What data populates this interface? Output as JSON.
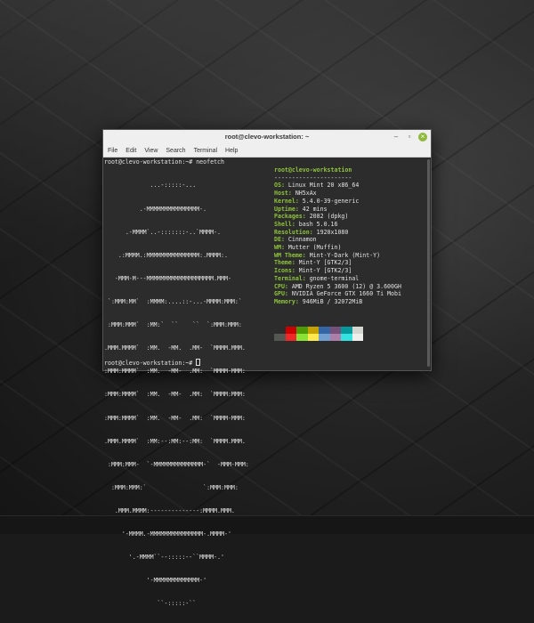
{
  "window": {
    "title": "root@clevo-workstation: ~",
    "controls": {
      "minimize": "‒",
      "maximize": "▫",
      "close": "×"
    }
  },
  "menu": [
    "File",
    "Edit",
    "View",
    "Search",
    "Terminal",
    "Help"
  ],
  "terminal": {
    "prompt_command": "root@clevo-workstation:~# neofetch",
    "ascii_logo": [
      "             ...-:::::-...",
      "          .-MMMMMMMMMMMMMMM-.",
      "      .-MMMM`..-:::::::-..`MMMM-.",
      "    .:MMMM.:MMMMMMMMMMMMMMM:.MMMM:.",
      "   -MMM-M---MMMMMMMMMMMMMMMMMMM.MMM-",
      " `:MMM:MM`  :MMMM:....::-...-MMMM:MMM:`",
      " :MMM:MMM`  :MM:`  ``    ``  `:MMM:MMM:",
      ".MMM.MMMM`  :MM.  -MM.  .MM-  `MMMM.MMM.",
      ":MMM:MMMM`  :MM.  -MM-  .MM:  `MMMM-MMM:",
      ":MMM:MMMM`  :MM.  -MM-  .MM:  `MMMM:MMM:",
      ":MMM:MMMM`  :MM.  -MM-  .MM:  `MMMM-MMM:",
      ".MMM.MMMM`  :MM:--:MM:--:MM:  `MMMM.MMM.",
      " :MMM:MMM-  `-MMMMMMMMMMMMMM-`  -MMM-MMM:",
      "  :MMM:MMM:`                `:MMM:MMM:",
      "   .MMM.MMMM:--------------:MMMM.MMM.",
      "     '-MMMM.-MMMMMMMMMMMMMMM-.MMMM-'",
      "       '.-MMMM``--:::::--``MMMM-.'",
      "            '-MMMMMMMMMMMMM-'",
      "               ``-:::::-``"
    ],
    "user_host": "root@clevo-workstation",
    "separator": "----------------------",
    "info": [
      {
        "key": "OS",
        "value": "Linux Mint 20 x86_64"
      },
      {
        "key": "Host",
        "value": "NH5xAx"
      },
      {
        "key": "Kernel",
        "value": "5.4.0-39-generic"
      },
      {
        "key": "Uptime",
        "value": "42 mins"
      },
      {
        "key": "Packages",
        "value": "2082 (dpkg)"
      },
      {
        "key": "Shell",
        "value": "bash 5.0.16"
      },
      {
        "key": "Resolution",
        "value": "1920x1080"
      },
      {
        "key": "DE",
        "value": "Cinnamon"
      },
      {
        "key": "WM",
        "value": "Mutter (Muffin)"
      },
      {
        "key": "WM Theme",
        "value": "Mint-Y-Dark (Mint-Y)"
      },
      {
        "key": "Theme",
        "value": "Mint-Y [GTK2/3]"
      },
      {
        "key": "Icons",
        "value": "Mint-Y [GTK2/3]"
      },
      {
        "key": "Terminal",
        "value": "gnome-terminal"
      },
      {
        "key": "CPU",
        "value": "AMD Ryzen 5 3600 (12) @ 3.600GH"
      },
      {
        "key": "GPU",
        "value": "NVIDIA GeForce GTX 1660 Ti Mobi"
      },
      {
        "key": "Memory",
        "value": "946MiB / 32072MiB"
      }
    ],
    "palette_dark": [
      "#2c2c2c",
      "#cc0000",
      "#4e9a06",
      "#c4a000",
      "#3465a4",
      "#75507b",
      "#06989a",
      "#d3d7cf"
    ],
    "palette_bright": [
      "#555753",
      "#ef2929",
      "#8ae234",
      "#fce94f",
      "#729fcf",
      "#ad7fa8",
      "#34e2e2",
      "#eeeeec"
    ],
    "final_prompt": "root@clevo-workstation:~# "
  }
}
